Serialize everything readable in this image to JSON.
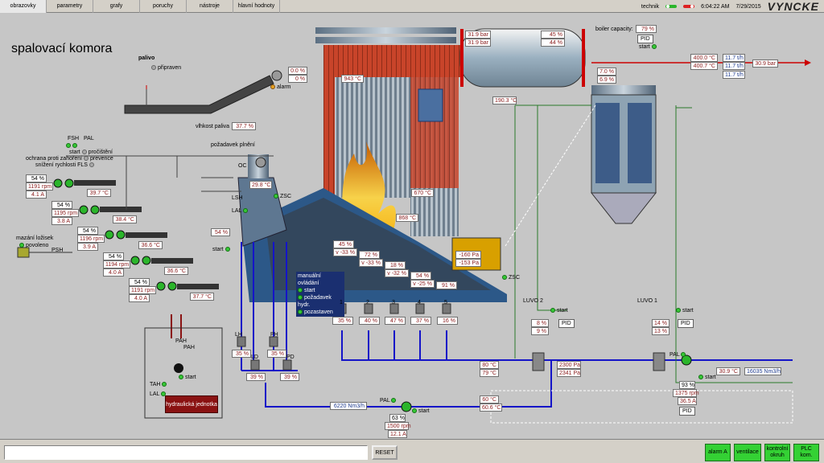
{
  "menu": {
    "items": [
      "obrazovky",
      "parametry",
      "grafy",
      "poruchy",
      "nástroje",
      "hlavní hodnoty"
    ],
    "user": "technik",
    "time": "6:04:22 AM",
    "date": "7/29/2015",
    "brand": "VYNCKE"
  },
  "page": {
    "title": "spalovací komora"
  },
  "fuel": {
    "palivo_label": "palivo",
    "pripraven_label": "připraven",
    "motor_label": "M",
    "motor_values": [
      "0.0 %",
      "0 %"
    ],
    "alarm_label": "alarm",
    "vlhkost_label": "vlhkost paliva",
    "vlhkost_value": "37.7 %",
    "pozadavek_label": "požadavek plnění",
    "fsh_label": "FSH",
    "pal_label": "PAL",
    "start_label": "start",
    "procisteni_label": "pročištění",
    "ochrana_label": "ochrana proti zahoření",
    "prevence_label": "prevence",
    "snizeni_label": "snížení rychlosti FLS",
    "oc_label": "OC",
    "oc_value": "29.8 °C",
    "zsc_label": "ZSC",
    "lsh_label": "LSH",
    "lal_label": "LAL",
    "feed_value": "54 %",
    "feed_start": "start"
  },
  "screws": [
    {
      "num": "1",
      "pct": "54 %",
      "rpm": "1191 rpm",
      "amp": "4.1 A",
      "temp": "39.7 °C"
    },
    {
      "num": "2",
      "pct": "54 %",
      "rpm": "1195 rpm",
      "amp": "3.8 A",
      "temp": "38.4 °C"
    },
    {
      "num": "3",
      "pct": "54 %",
      "rpm": "1196 rpm",
      "amp": "3.9 A",
      "temp": "36.6 °C"
    },
    {
      "num": "4",
      "pct": "54 %",
      "rpm": "1194 rpm",
      "amp": "4.0 A",
      "temp": "36.6 °C"
    },
    {
      "num": "5",
      "pct": "54 %",
      "rpm": "1191 rpm",
      "amp": "4.0 A",
      "temp": "37.7 °C"
    }
  ],
  "lubrication": {
    "label": "mazání ložisek",
    "povoleno": "povoleno",
    "psh": "PSH"
  },
  "hydraulic": {
    "pah1": "PAH",
    "pah2": "PAH",
    "tah": "TAH",
    "lal": "LAL",
    "start": "start",
    "label": "hydraulická jednotka"
  },
  "boiler": {
    "furnace_temp": "943 °C",
    "t670": "670 °C",
    "t868": "868 °C",
    "drum_pressure_1": "31.9 bar",
    "drum_pressure_2": "31.9 bar",
    "drum_level_1": "45 %",
    "drum_level_2": "44 %",
    "capacity_label": "boiler capacity:",
    "capacity_value": "79 %",
    "pid": "PID",
    "start": "start",
    "steam_temp_1": "400.0 °C",
    "steam_temp_2": "400.7 °C",
    "steam_flow_1": "11.7 t/h",
    "steam_flow_2": "11.7 t/h",
    "steam_flow_3": "11.7 t/h",
    "steam_pressure": "30.9 bar",
    "eco_temp": "190.3 °C",
    "eco_pct_1": "7.0 %",
    "eco_pct_2": "6.9 %",
    "pressure_1": "-160 Pa",
    "pressure_2": "-153 Pa",
    "zsc": "ZSC"
  },
  "grate": {
    "zones": [
      {
        "a": "45 %",
        "b": "v -33 %"
      },
      {
        "a": "72 %",
        "b": "v -33 %"
      },
      {
        "a": "18 %",
        "b": "v -32 %"
      },
      {
        "a": "54 %",
        "b": "v -25 %"
      },
      {
        "a": "91 %",
        "b": ""
      }
    ],
    "manual_title": "manuální ovládání",
    "manual_items": [
      "start",
      "požadavek hydr.",
      "pozastaven"
    ]
  },
  "dampers": {
    "nums": [
      "1",
      "2",
      "3",
      "4",
      "5"
    ],
    "values": [
      "35 %",
      "40 %",
      "47 %",
      "37 %",
      "16 %"
    ],
    "lh_label": "LH",
    "lh_value": "35 %",
    "ph_label": "PH",
    "ph_value": "35 %",
    "ld_label": "LD",
    "ld_value": "39 %",
    "pd_label": "PD",
    "pd_value": "39 %"
  },
  "luvo": {
    "luvo2_label": "LUVO 2",
    "luvo2_start": "start",
    "luvo2_v1": "8 %",
    "luvo2_v2": "9 %",
    "luvo2_pid": "PID",
    "luvo1_label": "LUVO 1",
    "luvo1_start": "start",
    "luvo1_v1": "14 %",
    "luvo1_v2": "13 %",
    "luvo1_pid": "PID"
  },
  "air": {
    "t1": "80 °C",
    "t2": "79 °C",
    "p1": "2300 Pa",
    "p2": "2341 Pa",
    "pal": "PAL",
    "fan_temp": "30.9 °C",
    "fan_flow": "16035 Nm3/h",
    "fan_start": "start",
    "fan_pct": "93 %",
    "fan_rpm": "1375 rpm",
    "fan_amp": "36.5 A",
    "fan_pid": "PID",
    "sec_flow": "6220 Nm3/h",
    "sec_pal": "PAL",
    "sec_start": "start",
    "sec_t1": "60 °C",
    "sec_t2": "60.6 °C",
    "sec_pct": "63 %",
    "sec_rpm": "1500 rpm",
    "sec_amp": "12.1 A"
  },
  "status": {
    "message": "",
    "reset": "RESET",
    "buttons": [
      "alarm A",
      "ventilace",
      "kontrolní okruh",
      "PLC kom."
    ]
  }
}
